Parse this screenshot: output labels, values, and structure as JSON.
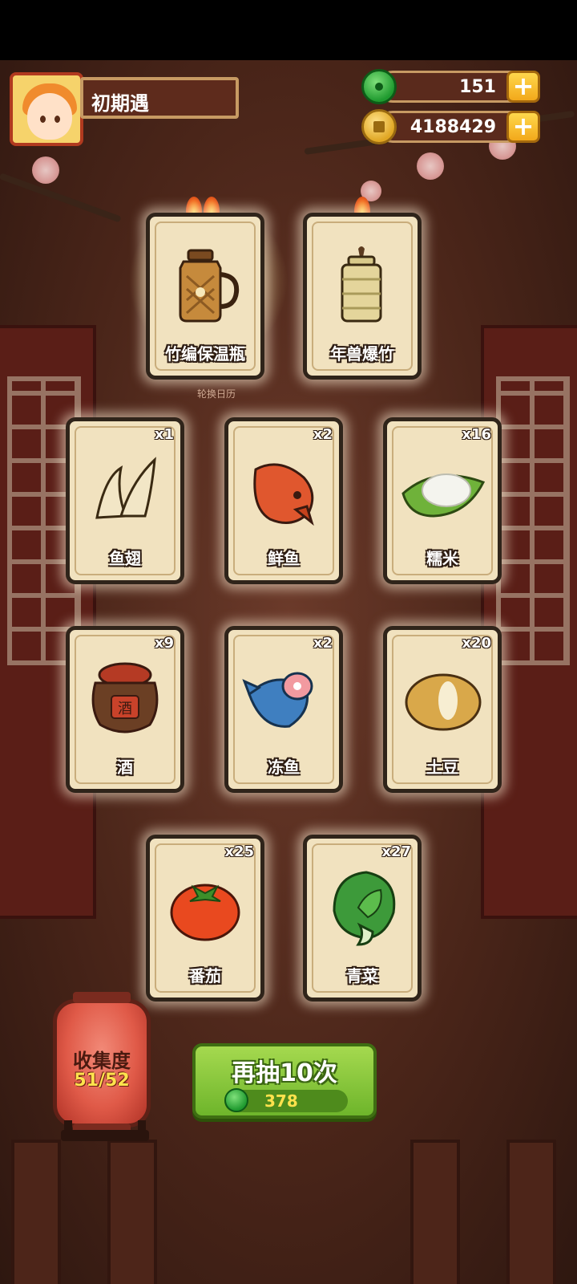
{
  "player": {
    "name": "初期遇",
    "avatar_icon": "girl-avatar-icon"
  },
  "currencies": [
    {
      "id": "jade",
      "icon": "jade-icon",
      "value": "151",
      "add_icon": "plus-icon"
    },
    {
      "id": "coin",
      "icon": "coin-icon",
      "value": "4188429",
      "add_icon": "plus-icon"
    }
  ],
  "calendar_label": "轮换日历",
  "cards": [
    {
      "id": "thermos",
      "label": "竹编保温瓶",
      "count": "",
      "fires": 2,
      "icon": "bamboo-thermos-icon"
    },
    {
      "id": "firecracker",
      "label": "年兽爆竹",
      "count": "",
      "fires": 1,
      "icon": "firecracker-icon"
    },
    {
      "id": "shark-fin",
      "label": "鱼翅",
      "count": "x1",
      "icon": "shark-fin-icon"
    },
    {
      "id": "fresh-fish",
      "label": "鲜鱼",
      "count": "x2",
      "icon": "fresh-fish-icon"
    },
    {
      "id": "glutinous-rice",
      "label": "糯米",
      "count": "x16",
      "icon": "glutinous-rice-icon"
    },
    {
      "id": "wine",
      "label": "酒",
      "count": "x9",
      "icon": "wine-jar-icon",
      "jar_text": "酒"
    },
    {
      "id": "frozen-fish",
      "label": "冻鱼",
      "count": "x2",
      "icon": "frozen-fish-icon"
    },
    {
      "id": "potato",
      "label": "土豆",
      "count": "x20",
      "icon": "potato-icon"
    },
    {
      "id": "tomato",
      "label": "番茄",
      "count": "x25",
      "icon": "tomato-icon"
    },
    {
      "id": "greens",
      "label": "青菜",
      "count": "x27",
      "icon": "bok-choy-icon"
    }
  ],
  "collection": {
    "title": "收集度",
    "value": "51/52"
  },
  "draw_button": {
    "label": "再抽10次",
    "cost": "378",
    "cost_icon": "jade-icon"
  },
  "colors": {
    "card_bg": "#f1e2bf",
    "button_green": "#6eb52b",
    "lantern_red": "#e05a48"
  }
}
